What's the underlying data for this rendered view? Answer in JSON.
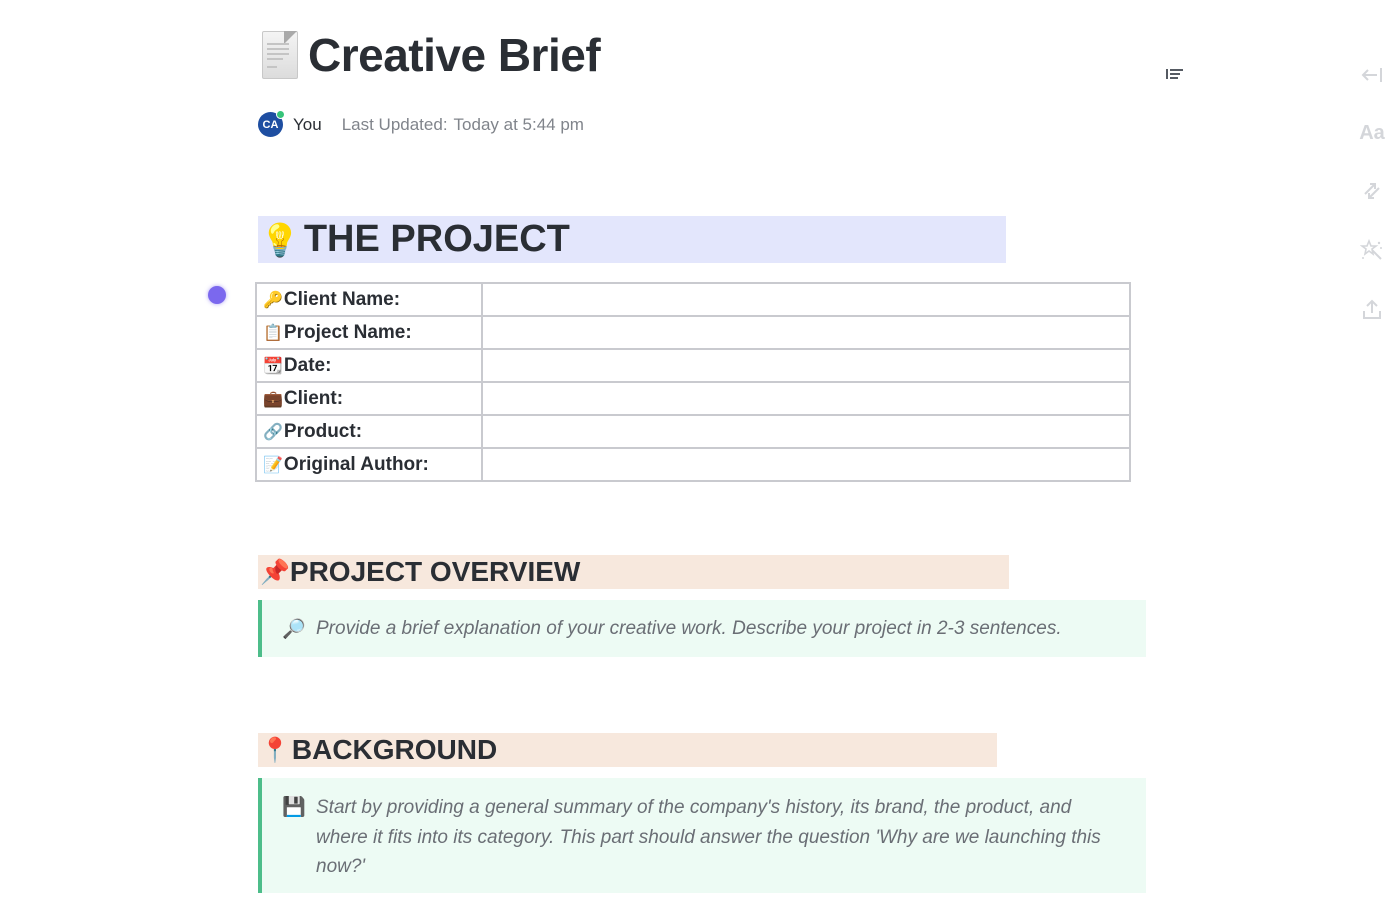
{
  "document": {
    "title": "Creative Brief",
    "title_icon": "document-page-icon"
  },
  "meta": {
    "avatar_initials": "CA",
    "author": "You",
    "last_updated_label": "Last Updated:",
    "last_updated_value": "Today at 5:44 pm"
  },
  "toolbar": {
    "table_of_contents_icon": "table-of-contents-icon",
    "side_tools": [
      {
        "name": "collapse-panel-icon",
        "glyph": "←|"
      },
      {
        "name": "typography-icon",
        "glyph": "Aa"
      },
      {
        "name": "sync-icon",
        "glyph": "⇅"
      },
      {
        "name": "ai-magic-wand-icon",
        "glyph": "✨"
      },
      {
        "name": "share-export-icon",
        "glyph": "⇪"
      }
    ]
  },
  "sections": {
    "project": {
      "heading": "THE PROJECT",
      "emoji": "💡",
      "highlight_color": "#e3e6fc",
      "rows": [
        {
          "emoji": "🔑",
          "icon": "key-icon",
          "label": "Client Name:",
          "value": ""
        },
        {
          "emoji": "📋",
          "icon": "clipboard-icon",
          "label": "Project Name:",
          "value": ""
        },
        {
          "emoji": "📆",
          "icon": "calendar-icon",
          "label": "Date:",
          "value": ""
        },
        {
          "emoji": "💼",
          "icon": "briefcase-icon",
          "label": "Client:",
          "value": ""
        },
        {
          "emoji": "🔗",
          "icon": "link-icon",
          "label": "Product:",
          "value": ""
        },
        {
          "emoji": "📝",
          "icon": "memo-icon",
          "label": "Original Author:",
          "value": ""
        }
      ]
    },
    "overview": {
      "heading": "PROJECT OVERVIEW",
      "emoji": "📌",
      "highlight_color": "#f7e8dd",
      "callout_emoji": "🔎",
      "callout_text": "Provide a brief explanation of your creative work. Describe your project in 2-3 sentences."
    },
    "background": {
      "heading": "BACKGROUND",
      "emoji": "📍",
      "highlight_color": "#f7e8dd",
      "callout_emoji": "💾",
      "callout_text": "Start by providing a general summary of the company's history, its brand, the product, and where it fits into its category. This part should answer the question 'Why are we launching this now?'"
    }
  },
  "colors": {
    "accent_purple": "#7b68ee",
    "callout_bg": "#edfbf4",
    "callout_border": "#4dbd8a",
    "text_primary": "#2a2e34",
    "text_muted": "#80848b"
  }
}
